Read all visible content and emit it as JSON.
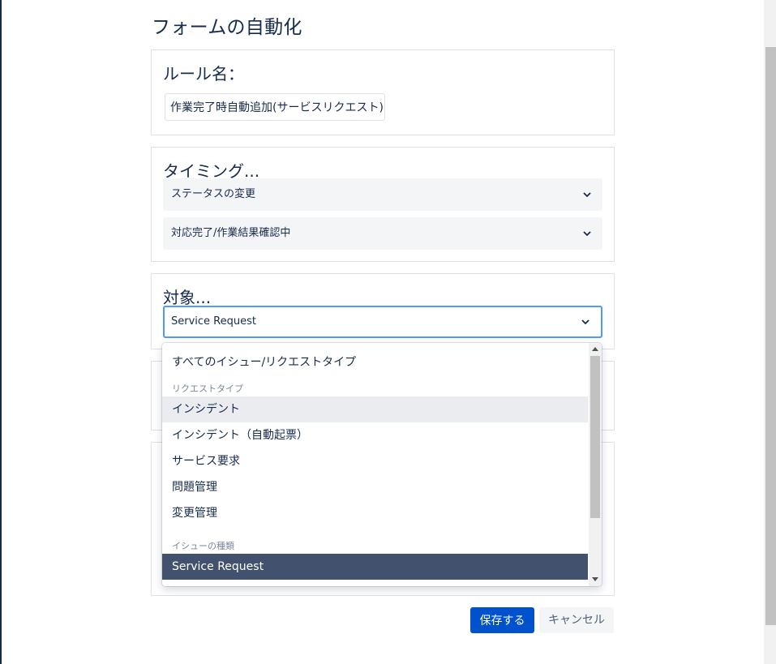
{
  "page": {
    "title": "フォームの自動化"
  },
  "rule_name": {
    "label": "ルール名：",
    "value": "作業完了時自動追加(サービスリクエスト)"
  },
  "timing": {
    "label": "タイミング...",
    "trigger_select": "ステータスの変更",
    "status_select": "対応完了/作業結果確認中"
  },
  "target": {
    "label": "対象...",
    "selected": "Service Request"
  },
  "dropdown": {
    "all_option": "すべてのイシュー/リクエストタイプ",
    "request_types_group": "リクエストタイプ",
    "request_types": [
      "インシデント",
      "インシデント（自動起票）",
      "サービス要求",
      "問題管理",
      "変更管理"
    ],
    "issue_types_group": "イシューの種類",
    "issue_types": [
      "Service Request"
    ]
  },
  "actions": {
    "save_label": "保存する",
    "cancel_label": "キャンセル"
  },
  "colors": {
    "primary": "#0052cc",
    "selected_option": "#42526e",
    "focus_border": "#4c9aff"
  },
  "icons": {
    "select_indicator": "chevron-down-icon"
  }
}
